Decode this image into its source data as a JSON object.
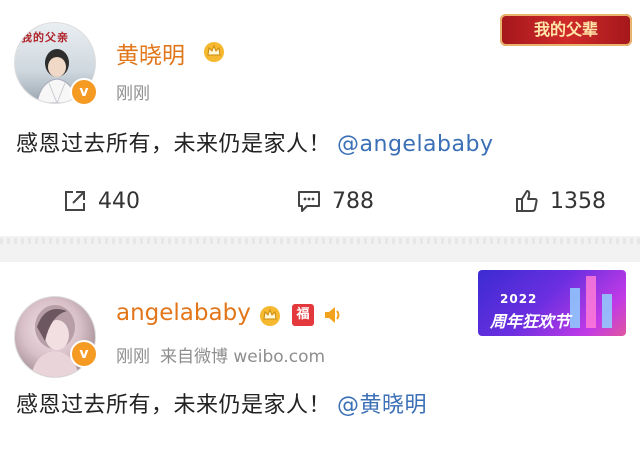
{
  "posts": [
    {
      "username": "黄晓明",
      "time": "刚刚",
      "source": "",
      "content": "感恩过去所有，未来仍是家人！",
      "mention": "@angelababy",
      "avatar_text": "我的父亲",
      "verified_mark": "v",
      "banner_text": "我的父辈",
      "share_count": "440",
      "comment_count": "788",
      "like_count": "1358"
    },
    {
      "username": "angelababy",
      "time": "刚刚",
      "source": "来自微博 weibo.com",
      "content": "感恩过去所有，未来仍是家人！",
      "mention": "@黄晓明",
      "verified_mark": "v",
      "fans_badge_text": "福",
      "banner_year": "2022",
      "banner_text": "周年狂欢节"
    }
  ],
  "colors": {
    "username": "#e2761b",
    "mention": "#3b6fb6",
    "meta": "#8e8e8e",
    "verified": "#f59a23"
  },
  "icons": [
    "share-icon",
    "comment-icon",
    "like-icon",
    "crown-icon",
    "speaker-icon",
    "fans-badge-icon"
  ]
}
